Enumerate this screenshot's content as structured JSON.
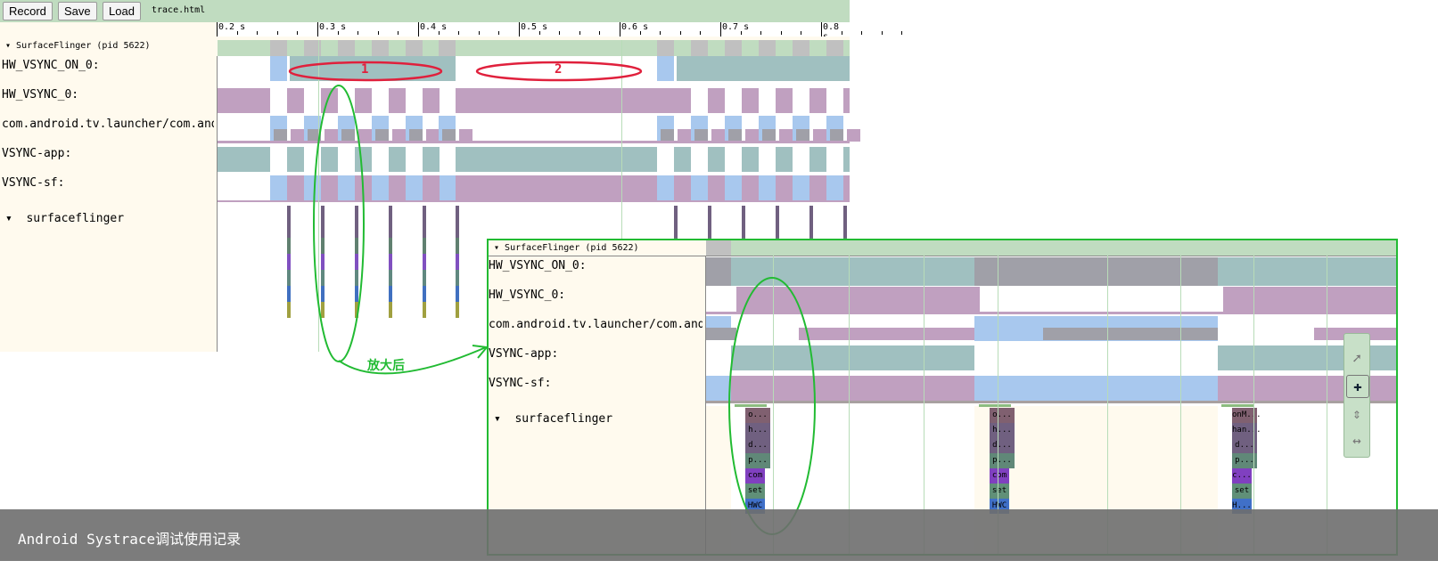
{
  "toolbar": {
    "record": "Record",
    "save": "Save",
    "load": "Load",
    "filename": "trace.html"
  },
  "ruler": {
    "ticks": [
      "0.2 s",
      "0.3 s",
      "0.4 s",
      "0.5 s",
      "0.6 s",
      "0.7 s",
      "0.8 s"
    ]
  },
  "process": {
    "header": "SurfaceFlinger (pid 5622)"
  },
  "tracks": {
    "hw_vsync_on": "HW_VSYNC_ON_0:",
    "hw_vsync": "HW_VSYNC_0:",
    "launcher": "com.android.tv.launcher/com.android",
    "vsync_app": "VSYNC-app:",
    "vsync_sf": "VSYNC-sf:",
    "thread": "surfaceflinger"
  },
  "annotations": {
    "region1": "1",
    "region2": "2",
    "zoom_label": "放大后"
  },
  "slices": {
    "group1": [
      "o...",
      "h...",
      "d...",
      "p...",
      "com",
      "set",
      "HWC"
    ],
    "group2": [
      "o...",
      "h...",
      "d...",
      "p...",
      "com",
      "set",
      "HWC"
    ],
    "group3": [
      "onM...",
      "han...",
      "d...",
      "p...",
      "c...",
      "set",
      "H..."
    ]
  },
  "nav_tools": [
    "select-icon",
    "pan-icon",
    "zoom-icon",
    "timing-icon"
  ],
  "caption": "Android Systrace调试使用记录",
  "colors": {
    "teal": "#a0c0c0",
    "purple": "#c0a0c0",
    "blue": "#a8c8ee",
    "gray": "#a0a0a8",
    "green_bg": "#c0dcc0",
    "cream": "#fffaee",
    "annot_red": "#e0203c",
    "annot_green": "#22bb33"
  }
}
